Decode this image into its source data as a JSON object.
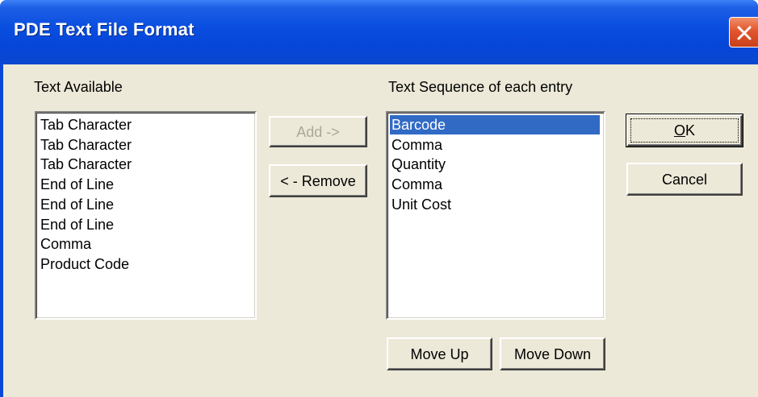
{
  "window": {
    "title": "PDE Text File Format",
    "close_icon": "close-icon",
    "colors": {
      "titlebar": "#0a4fe0",
      "client": "#ece9d8",
      "selection": "#316ac5",
      "close": "#e2552d"
    }
  },
  "available": {
    "label": "Text Available",
    "items": [
      "Tab Character",
      "Tab Character",
      "Tab Character",
      "End of Line",
      "End of Line",
      "End of Line",
      "Comma",
      "Product Code"
    ]
  },
  "sequence": {
    "label": "Text Sequence of each entry",
    "selected_index": 0,
    "items": [
      "Barcode",
      "Comma",
      "Quantity",
      "Comma",
      "Unit Cost"
    ]
  },
  "buttons": {
    "add": "Add ->",
    "remove": "< - Remove",
    "ok_mnemonic": "O",
    "ok_rest": "K",
    "cancel": "Cancel",
    "move_up": "Move Up",
    "move_down": "Move Down"
  }
}
